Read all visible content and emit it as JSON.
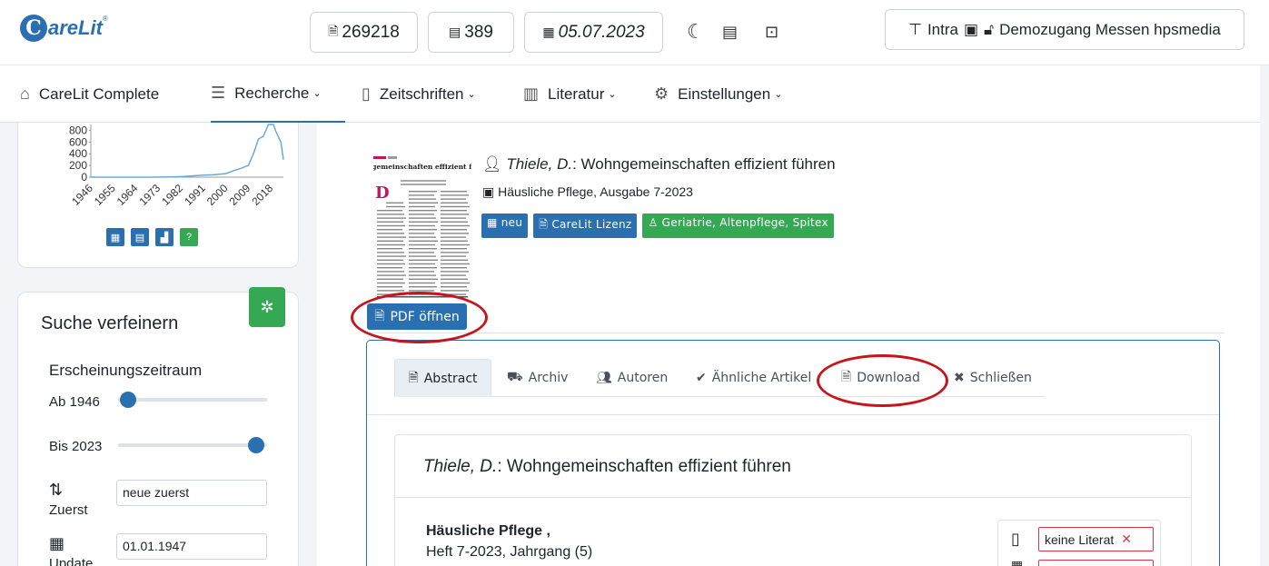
{
  "header": {
    "logo": "CareLit",
    "logo_reg": "®",
    "count_articles": "269218",
    "count_journals": "389",
    "date": "05.07.2023",
    "user_prefix": "Intra",
    "user_name": "Demozugang Messen hpsmedia"
  },
  "nav": {
    "items": [
      {
        "label": "CareLit Complete",
        "icon": "home-icon"
      },
      {
        "label": "Recherche",
        "icon": "search-list-icon"
      },
      {
        "label": "Zeitschriften",
        "icon": "journal-icon"
      },
      {
        "label": "Literatur",
        "icon": "books-icon"
      },
      {
        "label": "Einstellungen",
        "icon": "gear-icon"
      }
    ],
    "active": "Recherche"
  },
  "chart_data": {
    "type": "line",
    "x": [
      1946,
      1955,
      1964,
      1973,
      1982,
      1991,
      2000,
      2009,
      2018
    ],
    "xtick_labels": [
      "1946",
      "1955",
      "1964",
      "1973",
      "1982",
      "1991",
      "2000",
      "2009",
      "2018"
    ],
    "ytick_labels": [
      "0",
      "200",
      "400",
      "600",
      "800"
    ],
    "ylim": [
      0,
      900
    ],
    "series": [
      {
        "values_x": [
          1946,
          1950,
          1955,
          1960,
          1964,
          1970,
          1973,
          1978,
          1982,
          1986,
          1991,
          1995,
          2000,
          2003,
          2006,
          2009,
          2011,
          2013,
          2015,
          2017,
          2019,
          2020,
          2022,
          2023
        ],
        "values_y": [
          0,
          0,
          0,
          0,
          0,
          0,
          2,
          5,
          10,
          20,
          35,
          40,
          60,
          110,
          150,
          200,
          400,
          650,
          700,
          900,
          950,
          780,
          600,
          300
        ]
      }
    ],
    "grid": false
  },
  "sidebar": {
    "filter_title": "Suche verfeinern",
    "period_label": "Erscheinungszeitraum",
    "from_label": "Ab 1946",
    "from_value": 1946,
    "to_label": "Bis 2023",
    "to_value": 2023,
    "sort_label": "Zuerst",
    "sort_value": "neue zuerst",
    "update_label": "Update",
    "update_value": "01.01.1947"
  },
  "article": {
    "author": "Thiele, D.",
    "title": "Wohngemeinschaften effizient führen",
    "source": "Häusliche Pflege, Ausgabe 7-2023",
    "thumb_title": "Wohngemeinschaften effizient führen",
    "tags": [
      {
        "label": "neu",
        "icon": "calendar-icon",
        "color": "#2a6fb0"
      },
      {
        "label": "CareLit Lizenz",
        "icon": "pdf-icon",
        "color": "#2a6fb0"
      },
      {
        "label": "Geriatrie, Altenpflege, Spitex",
        "icon": "person-icon",
        "color": "#35a853"
      }
    ],
    "pdf_button": "PDF öffnen"
  },
  "tabs": [
    {
      "label": "Abstract",
      "icon": "document-icon"
    },
    {
      "label": "Archiv",
      "icon": "archive-icon"
    },
    {
      "label": "Autoren",
      "icon": "users-icon"
    },
    {
      "label": "Ähnliche Artikel",
      "icon": "check-circle-icon"
    },
    {
      "label": "Download",
      "icon": "pdf-icon"
    },
    {
      "label": "Schließen",
      "icon": "close-icon"
    }
  ],
  "detail": {
    "heading_author": "Thiele, D.",
    "heading_title": ": Wohngemeinschaften effizient führen",
    "journal": "Häusliche Pflege ,",
    "issue": "Heft 7-2023, Jahrgang (5)",
    "literature_value": "keine Literat"
  },
  "colors": {
    "brand": "#2a6fb0",
    "green": "#35a853",
    "highlight_ring": "#c8151b"
  }
}
